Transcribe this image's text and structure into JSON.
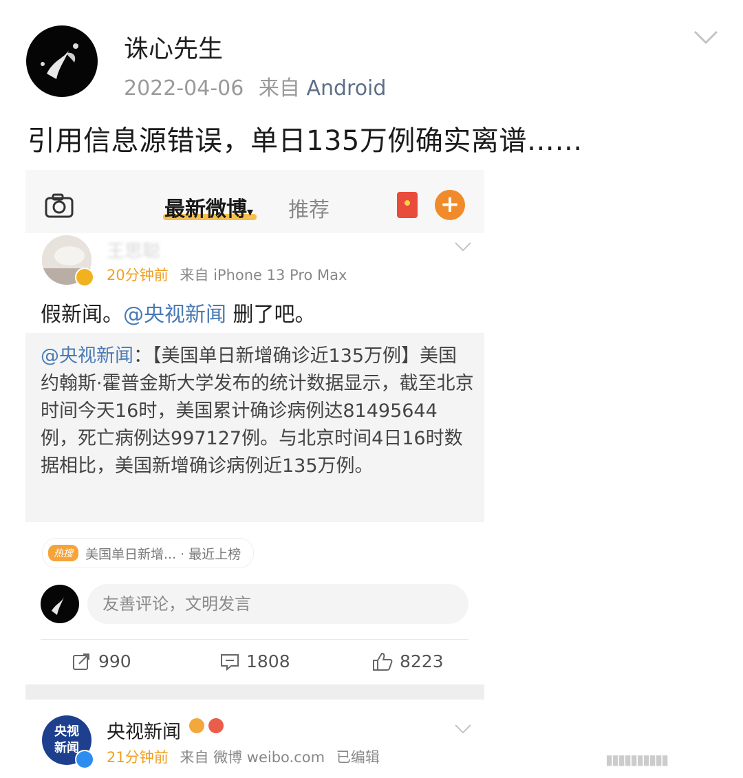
{
  "post": {
    "author": "诛心先生",
    "date": "2022-04-06",
    "source_prefix": "来自",
    "source": "Android",
    "text": "引用信息源错误，单日135万例确实离谱……"
  },
  "screenshot": {
    "tabs": {
      "latest": "最新微博",
      "latest_caret": "▾",
      "recommend": "推荐"
    },
    "add_label": "+",
    "inner_post": {
      "author": "王思聪",
      "time": "20分钟前",
      "source": "来自 iPhone 13 Pro Max",
      "text_before": "假新闻。",
      "mention": "@央视新闻",
      "text_after": " 删了吧。"
    },
    "repost": {
      "mention": "@央视新闻",
      "text": "：【美国单日新增确诊近135万例】美国约翰斯·霍普金斯大学发布的统计数据显示，截至北京时间今天16时，美国累计确诊病例达81495644例，死亡病例达997127例。与北京时间4日16时数据相比，美国新增确诊病例近135万例。"
    },
    "hot_tag": {
      "badge": "热搜",
      "text": "美国单日新增... · 最近上榜"
    },
    "comment_placeholder": "友善评论，文明发言",
    "actions": {
      "repost_count": "990",
      "comment_count": "1808",
      "like_count": "8223"
    },
    "next_post": {
      "avatar_text_1": "央视",
      "avatar_text_2": "新闻",
      "author": "央视新闻",
      "time": "21分钟前",
      "source": "来自 微博 weibo.com",
      "edited": "已编辑"
    }
  },
  "icons": [
    "camera-icon",
    "chevron-down-icon",
    "repost-icon",
    "comment-icon",
    "like-icon",
    "red-packet-icon",
    "verified-icon"
  ]
}
